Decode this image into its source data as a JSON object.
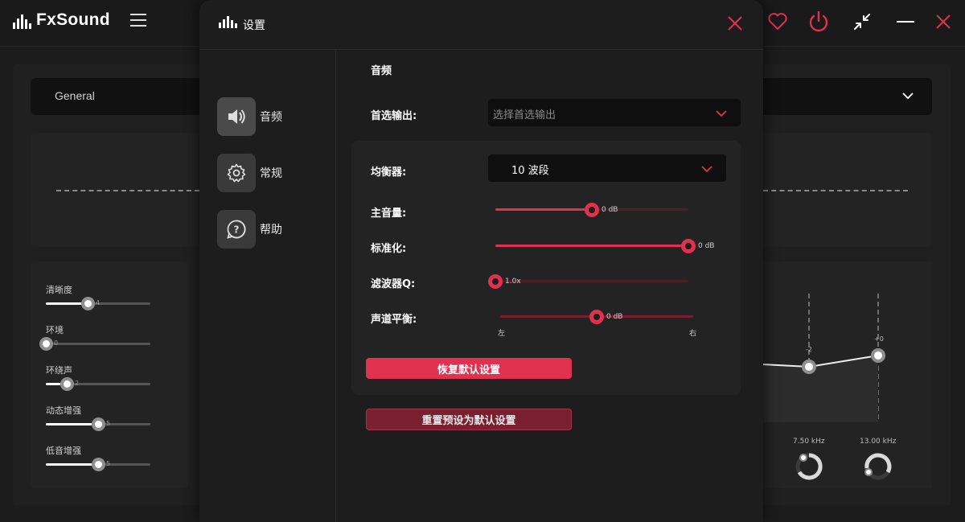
{
  "app": {
    "name": "FxSound",
    "preset": "General"
  },
  "background": {
    "effects": [
      {
        "label": "清晰度",
        "value": "4",
        "fraction": 0.4
      },
      {
        "label": "环境",
        "value": "0",
        "fraction": 0.0
      },
      {
        "label": "环绕声",
        "value": "2",
        "fraction": 0.2
      },
      {
        "label": "动态增强",
        "value": "5",
        "fraction": 0.5
      },
      {
        "label": "低音增强",
        "value": "5",
        "fraction": 0.5
      }
    ],
    "eq_bands": [
      {
        "freq": "7.50 kHz",
        "gain": "-2"
      },
      {
        "freq": "13.00 kHz",
        "gain": "+0"
      }
    ]
  },
  "dialog": {
    "title": "设置",
    "sidebar": [
      {
        "label": "音频",
        "icon": "speaker-icon"
      },
      {
        "label": "常规",
        "icon": "gear-icon"
      },
      {
        "label": "帮助",
        "icon": "help-icon"
      }
    ],
    "section_title": "音频",
    "output": {
      "label": "首选输出:",
      "placeholder": "选择首选输出"
    },
    "equalizer": {
      "label": "均衡器:",
      "value": "10 波段"
    },
    "master_volume": {
      "label": "主音量:",
      "value": "0 dB",
      "fraction": 0.5
    },
    "normalization": {
      "label": "标准化:",
      "value": "0 dB",
      "fraction": 1.0
    },
    "filter_q": {
      "label": "滤波器Q:",
      "value": "1.0x",
      "fraction": 0.0
    },
    "balance": {
      "label": "声道平衡:",
      "value": "0 dB",
      "fraction": 0.5,
      "left": "左",
      "right": "右"
    },
    "restore_defaults": "恢复默认设置",
    "reset_presets": "重置预设为默认设置"
  },
  "colors": {
    "accent": "#e0314f",
    "accent_dark": "#7a1f30",
    "background": "#1c1c1c",
    "dialog": "#1d1d1d"
  }
}
